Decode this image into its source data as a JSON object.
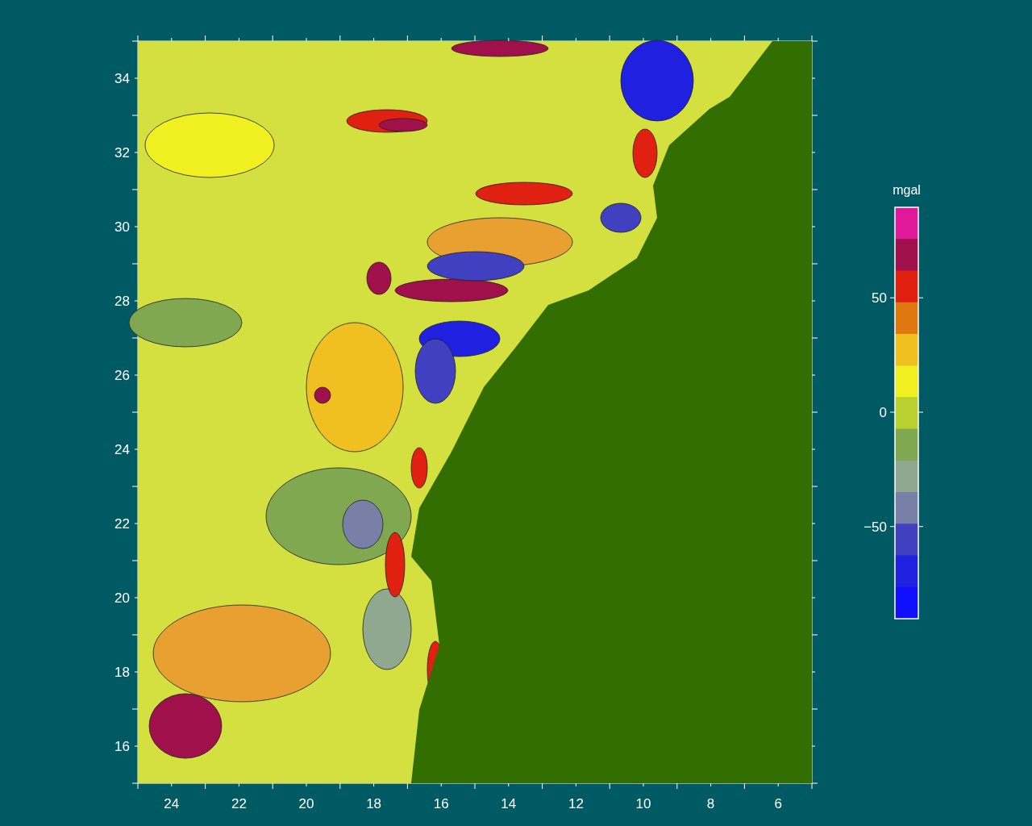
{
  "map": {
    "xticks": [
      "24",
      "22",
      "20",
      "18",
      "16",
      "14",
      "12",
      "10",
      "8",
      "6"
    ],
    "yticks": [
      "34",
      "32",
      "30",
      "28",
      "26",
      "24",
      "22",
      "20",
      "18",
      "16"
    ]
  },
  "colorbar": {
    "unit": "mgal",
    "ticks": [
      "50",
      "0",
      "−50"
    ],
    "bands": [
      {
        "color": "#e0189a"
      },
      {
        "color": "#a0104a"
      },
      {
        "color": "#e02010"
      },
      {
        "color": "#e07810"
      },
      {
        "color": "#f0c020"
      },
      {
        "color": "#f0f020"
      },
      {
        "color": "#b8d030"
      },
      {
        "color": "#80a850"
      },
      {
        "color": "#90a890"
      },
      {
        "color": "#7880a8"
      },
      {
        "color": "#4040c0"
      },
      {
        "color": "#2020e0"
      },
      {
        "color": "#1010ff"
      }
    ]
  }
}
